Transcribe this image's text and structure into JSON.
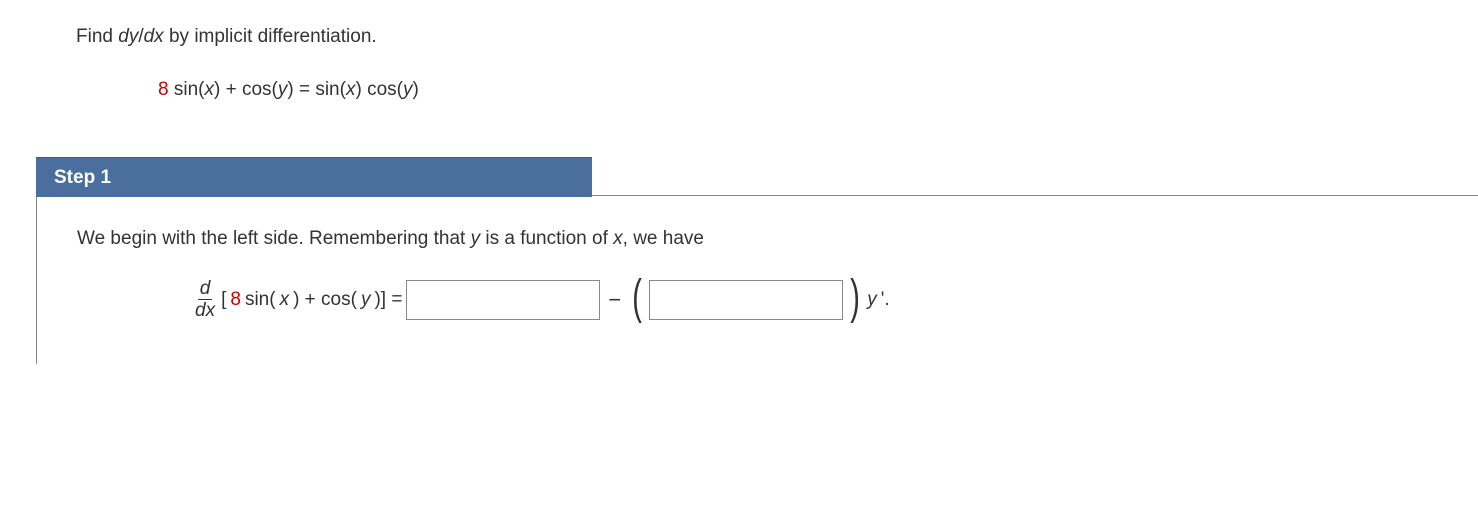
{
  "problem": {
    "prompt_prefix": "Find ",
    "prompt_dy": "dy",
    "prompt_slash": "/",
    "prompt_dx": "dx ",
    "prompt_suffix": "by implicit differentiation.",
    "coefficient": "8",
    "eq_part1": " sin(",
    "eq_x1": "x",
    "eq_part2": ") + cos(",
    "eq_y1": "y",
    "eq_part3": ") = sin(",
    "eq_x2": "x",
    "eq_part4": ") cos(",
    "eq_y2": "y",
    "eq_part5": ")"
  },
  "step": {
    "label": "Step 1",
    "text_part1": "We begin with the left side. Remembering that ",
    "text_y": "y",
    "text_part2": " is a function of ",
    "text_x": "x",
    "text_part3": ", we have",
    "frac_num": "d",
    "frac_den": "dx",
    "bracket_open": "[",
    "inner_coeff": "8",
    "inner_part1": " sin(",
    "inner_x": "x",
    "inner_part2": ") + cos(",
    "inner_y": "y",
    "inner_part3": ")] = ",
    "minus_text": "−",
    "paren_open": "(",
    "paren_close": ")",
    "yprime": "y",
    "yprime_prime": "'.",
    "input1_value": "",
    "input2_value": ""
  }
}
